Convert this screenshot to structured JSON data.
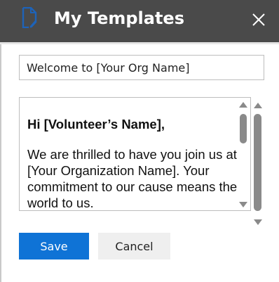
{
  "dialog": {
    "title": "My Templates",
    "colors": {
      "titlebar": "#4a4a4a",
      "accent": "#0f73d6",
      "icon": "#1e63b8"
    }
  },
  "subject": {
    "value": "Welcome to [Your Org Name]"
  },
  "body": {
    "greeting": "Hi [Volunteer’s Name],",
    "paragraph": "We are thrilled to have you join us at [Your Organization Name]. Your commitment to our cause means the world to us."
  },
  "buttons": {
    "save_label": "Save",
    "cancel_label": "Cancel"
  },
  "icons": {
    "title_icon": "document-edit-icon",
    "close_icon": "close-icon"
  }
}
